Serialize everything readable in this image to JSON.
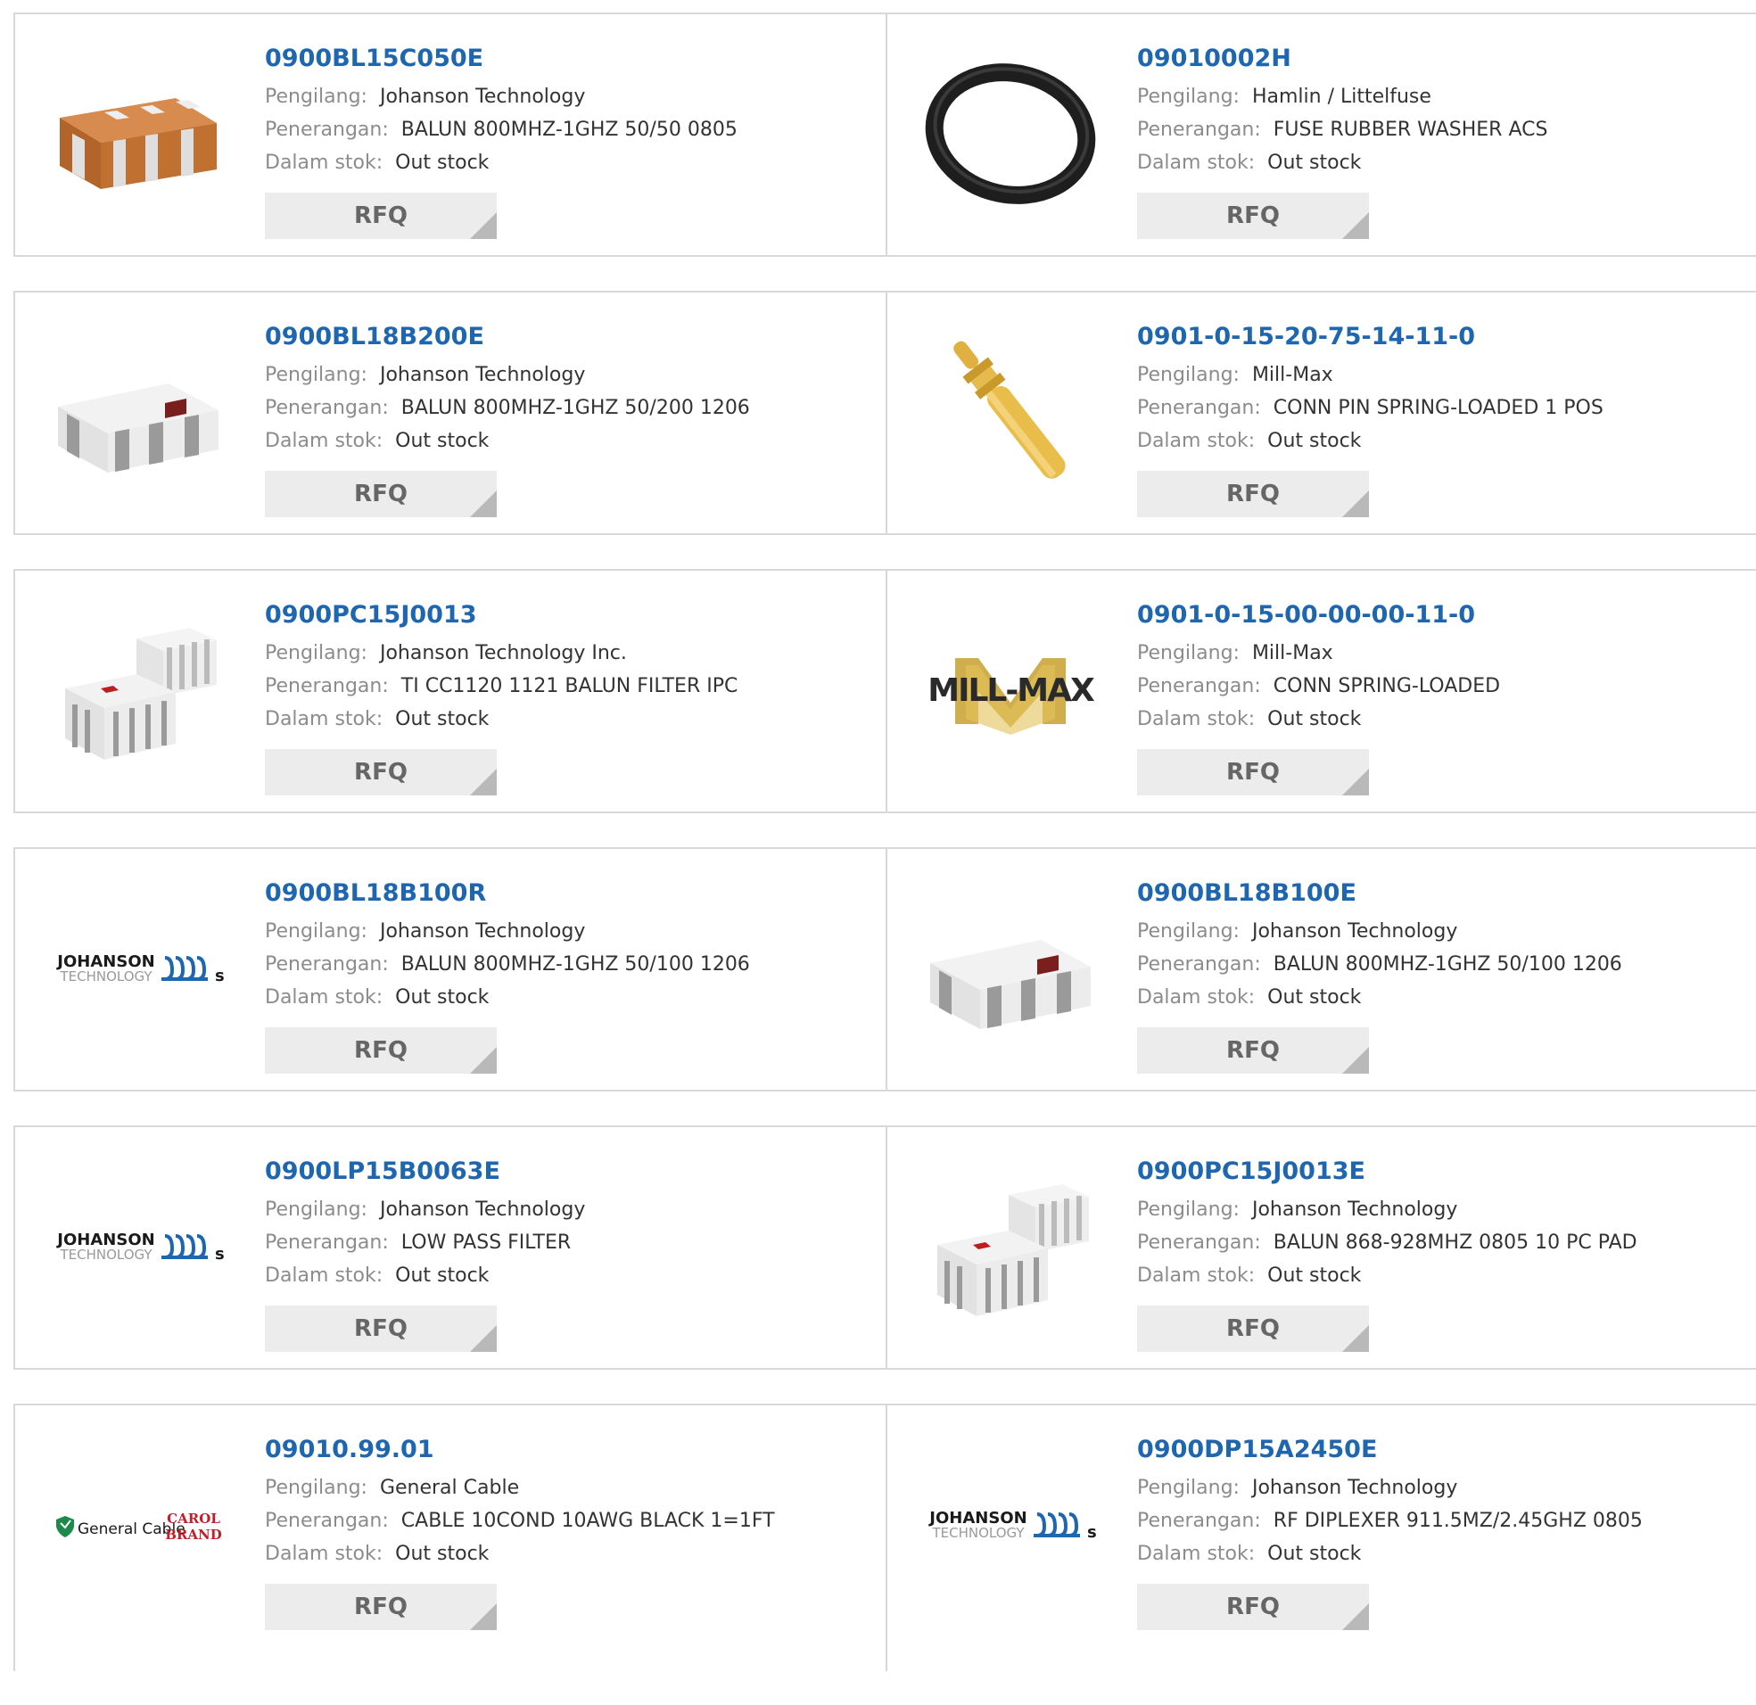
{
  "labels": {
    "manufacturer": "Pengilang:",
    "description": "Penerangan:",
    "stock": "Dalam stok:",
    "rfq": "RFQ"
  },
  "products": [
    {
      "part": "0900BL15C050E",
      "manufacturer": "Johanson Technology",
      "description": "BALUN 800MHZ-1GHZ 50/50 0805",
      "stock": "Out stock",
      "image": "orange-balun-chip-icon"
    },
    {
      "part": "09010002H",
      "manufacturer": "Hamlin / Littelfuse",
      "description": "FUSE RUBBER WASHER ACS",
      "stock": "Out stock",
      "image": "rubber-washer-icon"
    },
    {
      "part": "0900BL18B200E",
      "manufacturer": "Johanson Technology",
      "description": "BALUN 800MHZ-1GHZ 50/200 1206",
      "stock": "Out stock",
      "image": "white-balun-chip-icon"
    },
    {
      "part": "0901-0-15-20-75-14-11-0",
      "manufacturer": "Mill-Max",
      "description": "CONN PIN SPRING-LOADED 1 POS",
      "stock": "Out stock",
      "image": "spring-pin-icon"
    },
    {
      "part": "0900PC15J0013",
      "manufacturer": "Johanson Technology Inc.",
      "description": "TI CC1120 1121 BALUN FILTER IPC",
      "stock": "Out stock",
      "image": "balun-filter-pair-icon"
    },
    {
      "part": "0901-0-15-00-00-00-11-0",
      "manufacturer": "Mill-Max",
      "description": "CONN SPRING-LOADED",
      "stock": "Out stock",
      "image": "mill-max-logo",
      "logo_text": "MILL-MAX"
    },
    {
      "part": "0900BL18B100R",
      "manufacturer": "Johanson Technology",
      "description": "BALUN 800MHZ-1GHZ 50/100 1206",
      "stock": "Out stock",
      "image": "johanson-logo",
      "logo_text": "JOHANSON",
      "logo_sub": "TECHNOLOGY"
    },
    {
      "part": "0900BL18B100E",
      "manufacturer": "Johanson Technology",
      "description": "BALUN 800MHZ-1GHZ 50/100 1206",
      "stock": "Out stock",
      "image": "white-balun-chip-icon"
    },
    {
      "part": "0900LP15B0063E",
      "manufacturer": "Johanson Technology",
      "description": "LOW PASS FILTER",
      "stock": "Out stock",
      "image": "johanson-logo",
      "logo_text": "JOHANSON",
      "logo_sub": "TECHNOLOGY"
    },
    {
      "part": "0900PC15J0013E",
      "manufacturer": "Johanson Technology",
      "description": "BALUN 868-928MHZ 0805 10 PC PAD",
      "stock": "Out stock",
      "image": "balun-filter-pair-icon"
    },
    {
      "part": "09010.99.01",
      "manufacturer": "General Cable",
      "description": "CABLE 10COND 10AWG BLACK 1=1FT",
      "stock": "Out stock",
      "image": "general-cable-logo",
      "logo_text": "General Cable",
      "logo_sub": "CAROL BRAND"
    },
    {
      "part": "0900DP15A2450E",
      "manufacturer": "Johanson Technology",
      "description": "RF DIPLEXER 911.5MZ/2.45GHZ 0805",
      "stock": "Out stock",
      "image": "johanson-logo",
      "logo_text": "JOHANSON",
      "logo_sub": "TECHNOLOGY"
    }
  ],
  "colors": {
    "link": "#1f66b0",
    "label": "#8c8c8c",
    "value": "#333333",
    "button_bg": "#ececec",
    "button_text": "#666666",
    "border": "#d8d8d8"
  }
}
